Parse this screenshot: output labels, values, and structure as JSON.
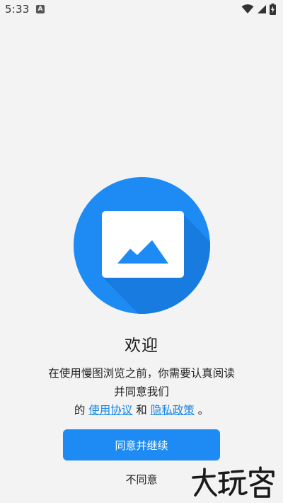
{
  "status_bar": {
    "time": "5:33",
    "notification_badge": "A",
    "icons": [
      "wifi-icon",
      "cellular-signal-icon",
      "battery-charging-icon"
    ]
  },
  "hero": {
    "icon": "image-icon",
    "circle_color": "#1e8bf5",
    "shadow_color": "#1469c4"
  },
  "welcome": {
    "title": "欢迎"
  },
  "notice": {
    "line1": "在使用慢图浏览之前，你需要认真阅读",
    "line2": "并同意我们",
    "prefix": "的",
    "terms_link": "使用协议",
    "conjunction": "和",
    "privacy_link": "隐私政策",
    "suffix": "。"
  },
  "buttons": {
    "agree_label": "同意并继续",
    "disagree_label": "不同意"
  },
  "watermark": {
    "text": "大玩客"
  },
  "colors": {
    "accent": "#1e8bf5",
    "link": "#1a86e6",
    "background": "#f3f3f3"
  }
}
